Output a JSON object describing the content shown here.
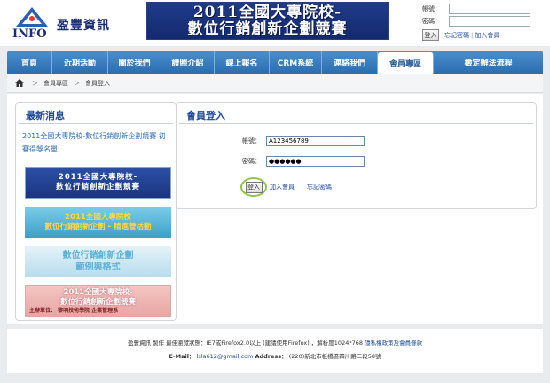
{
  "brand": {
    "name": "盈豐資訊",
    "logo_text": "INFO"
  },
  "banner": {
    "line1": "2011全國大專院校-",
    "line2": "數位行銷創新企劃競賽"
  },
  "top_login": {
    "account_label": "帳號：",
    "password_label": "密碼：",
    "login_button": "登入",
    "forgot_link": "忘記密碼",
    "separator": "|",
    "join_link": "加入會員"
  },
  "nav": {
    "items": [
      {
        "label": "首頁",
        "active": false
      },
      {
        "label": "近期活動",
        "active": false
      },
      {
        "label": "關於我們",
        "active": false
      },
      {
        "label": "證照介紹",
        "active": false
      },
      {
        "label": "線上報名",
        "active": false
      },
      {
        "label": "CRM系統",
        "active": false
      },
      {
        "label": "連絡我們",
        "active": false
      },
      {
        "label": "會員專區",
        "active": true
      },
      {
        "label": "檢定辦法流程",
        "active": false
      }
    ]
  },
  "breadcrumb": {
    "items": [
      "會員專區",
      "會員登入"
    ],
    "separator": "＞"
  },
  "sidebar": {
    "title": "最新消息",
    "news": "2011全國大專院校-數位行銷創新企劃競賽 初賽得獎名單",
    "ads": [
      {
        "line1": "2011全國大專院校-",
        "line2": "數位行銷創新企劃競賽"
      },
      {
        "line1": "2011全國大專院校",
        "line2": "數位行銷創新企劃 - 精進營活動"
      },
      {
        "line1": "數位行銷創新企劃",
        "line2": "範例與格式"
      },
      {
        "line1": "2011全國大專院校-",
        "line2": "數位行銷創新企劃競賽",
        "sub": "主辦單位： 黎明技術學院 企業管理系"
      }
    ]
  },
  "login_panel": {
    "title": "會員登入",
    "account_label": "帳號：",
    "account_value": "A123456789",
    "password_label": "密碼：",
    "password_value": "●●●●●●",
    "login_button": "登入",
    "join_link": "加入會員",
    "forgot_link": "忘記密碼"
  },
  "footer": {
    "line1_prefix": "盈豐資訊 製作 最佳瀏覽狀態：IE7或Firefox2.0以上 (建議使用Firefox) ，解析度1024*768 ",
    "privacy_link": "隱私權政策及會員條款",
    "email_label": "E-Mail：",
    "email": "lsla612@gmail.com",
    "address_label": "Address：",
    "address": "(220)新北市板橋區四川路二段58號"
  }
}
